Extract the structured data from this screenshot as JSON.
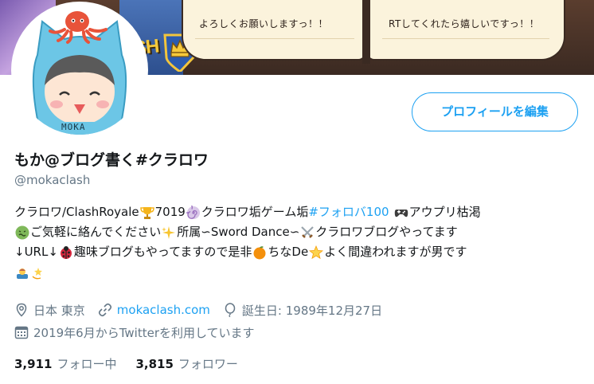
{
  "banner": {
    "page_left_text": "よろしくお願いしますっ！！",
    "page_right_text": "RTしてくれたら嬉しいですっ！！",
    "game_logo_text": "SH"
  },
  "avatar": {
    "badge_text": "MOKA"
  },
  "profile": {
    "edit_button_label": "プロフィールを編集",
    "display_name": "もか@ブログ書く#クラロワ",
    "screen_name": "@mokaclash"
  },
  "bio": {
    "line1": {
      "a": "クラロワ/ClashRoyale",
      "b": "7019",
      "c": "クラロワ垢ゲーム垢 ",
      "hashtag": "#フォロバ100",
      "d": "アウプリ枯渇"
    },
    "line2": {
      "a": "ご気軽に絡んでください",
      "b": "所属∽Sword Dance∽",
      "c": "クラロワブログやってます"
    },
    "line3": {
      "a": "↓URL↓",
      "b": "趣味ブログもやってますので是非",
      "c": "ちなDe",
      "d": "よく間違われますが男です"
    }
  },
  "meta": {
    "location": "日本 東京",
    "url": "mokaclash.com",
    "birthday": "誕生日: 1989年12月27日",
    "joined": "2019年6月からTwitterを利用しています"
  },
  "stats": {
    "following_count": "3,911",
    "following_label": "フォロー中",
    "followers_count": "3,815",
    "followers_label": "フォロワー"
  },
  "colors": {
    "accent": "#1da1f2",
    "secondary_text": "#657786",
    "primary_text": "#14171a"
  },
  "icons": [
    "location-icon",
    "link-icon",
    "balloon-icon",
    "calendar-icon"
  ]
}
